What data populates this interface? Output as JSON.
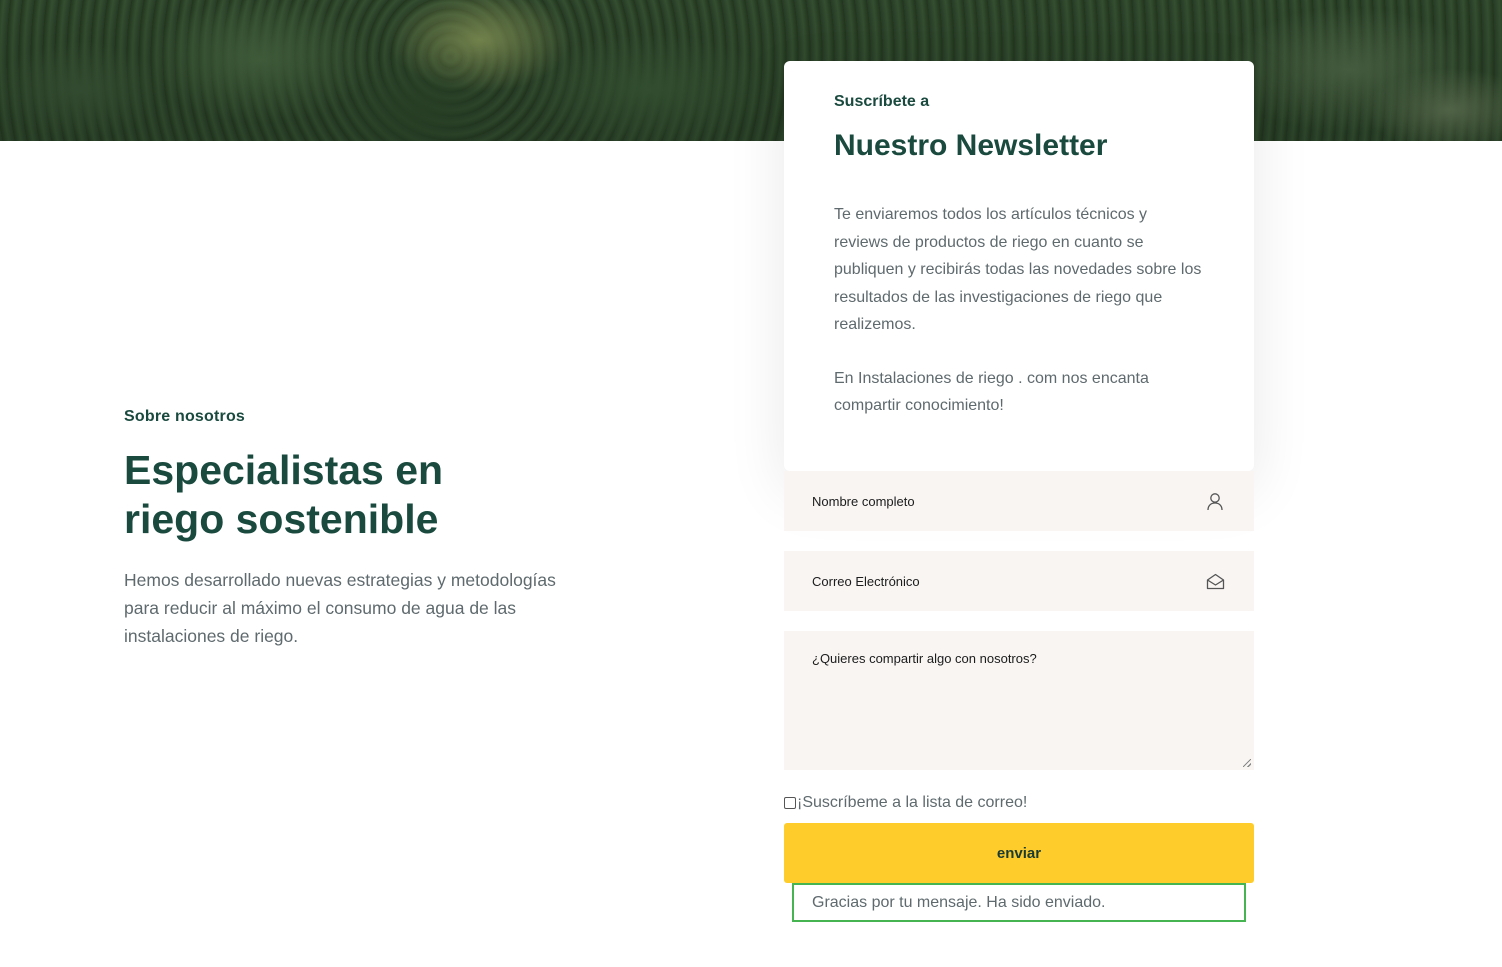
{
  "about": {
    "kicker": "Sobre nosotros",
    "title_line1": "Especialistas en",
    "title_line2": "riego sostenible",
    "text": "Hemos desarrollado nuevas estrategias y metodologías para reducir al máximo el consumo de agua de las instalaciones de riego."
  },
  "newsletter": {
    "kicker": "Suscríbete a",
    "title": "Nuestro Newsletter",
    "paragraph1": "Te enviaremos todos los artículos técnicos y reviews de productos de riego en cuanto se publiquen y recibirás todas las novedades sobre los resultados de las investigaciones de riego que realizemos.",
    "paragraph2": "En Instalaciones de riego . com nos encanta compartir conocimiento!"
  },
  "form": {
    "name_placeholder": "Nombre completo",
    "email_placeholder": "Correo Electrónico",
    "message_placeholder": "¿Quieres compartir algo con nosotros?",
    "subscribe_label": "¡Suscríbeme a la lista de correo!",
    "subscribe_checked": false,
    "submit_label": "enviar",
    "success_message": "Gracias por tu mensaje. Ha sido enviado."
  },
  "icons": {
    "name_field": "user-icon",
    "email_field": "envelope-open-icon"
  },
  "colors": {
    "heading": "#1a4a3e",
    "body_text": "#5f6a6e",
    "field_bg": "#f8f5f3",
    "button": "#fecd2c",
    "success_border": "#46b450"
  }
}
